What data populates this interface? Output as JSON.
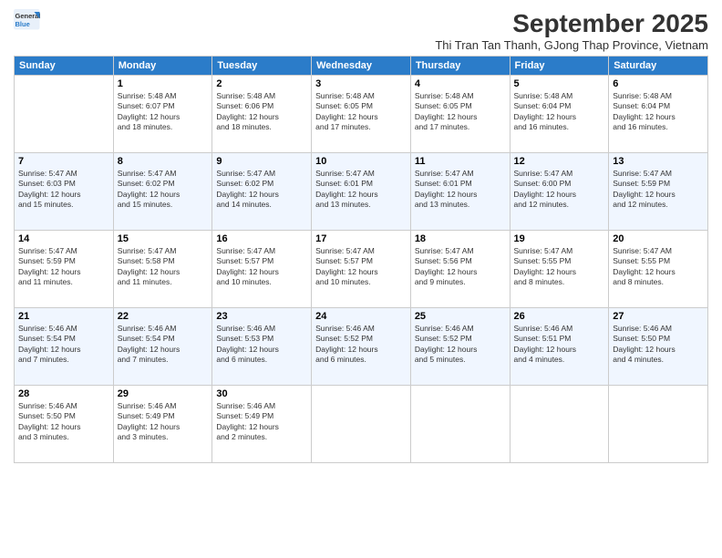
{
  "header": {
    "logo_line1": "General",
    "logo_line2": "Blue",
    "title": "September 2025",
    "subtitle": "Thi Tran Tan Thanh, GJong Thap Province, Vietnam"
  },
  "columns": [
    "Sunday",
    "Monday",
    "Tuesday",
    "Wednesday",
    "Thursday",
    "Friday",
    "Saturday"
  ],
  "weeks": [
    [
      {
        "day": "",
        "info": ""
      },
      {
        "day": "1",
        "info": "Sunrise: 5:48 AM\nSunset: 6:07 PM\nDaylight: 12 hours\nand 18 minutes."
      },
      {
        "day": "2",
        "info": "Sunrise: 5:48 AM\nSunset: 6:06 PM\nDaylight: 12 hours\nand 18 minutes."
      },
      {
        "day": "3",
        "info": "Sunrise: 5:48 AM\nSunset: 6:05 PM\nDaylight: 12 hours\nand 17 minutes."
      },
      {
        "day": "4",
        "info": "Sunrise: 5:48 AM\nSunset: 6:05 PM\nDaylight: 12 hours\nand 17 minutes."
      },
      {
        "day": "5",
        "info": "Sunrise: 5:48 AM\nSunset: 6:04 PM\nDaylight: 12 hours\nand 16 minutes."
      },
      {
        "day": "6",
        "info": "Sunrise: 5:48 AM\nSunset: 6:04 PM\nDaylight: 12 hours\nand 16 minutes."
      }
    ],
    [
      {
        "day": "7",
        "info": "Sunrise: 5:47 AM\nSunset: 6:03 PM\nDaylight: 12 hours\nand 15 minutes."
      },
      {
        "day": "8",
        "info": "Sunrise: 5:47 AM\nSunset: 6:02 PM\nDaylight: 12 hours\nand 15 minutes."
      },
      {
        "day": "9",
        "info": "Sunrise: 5:47 AM\nSunset: 6:02 PM\nDaylight: 12 hours\nand 14 minutes."
      },
      {
        "day": "10",
        "info": "Sunrise: 5:47 AM\nSunset: 6:01 PM\nDaylight: 12 hours\nand 13 minutes."
      },
      {
        "day": "11",
        "info": "Sunrise: 5:47 AM\nSunset: 6:01 PM\nDaylight: 12 hours\nand 13 minutes."
      },
      {
        "day": "12",
        "info": "Sunrise: 5:47 AM\nSunset: 6:00 PM\nDaylight: 12 hours\nand 12 minutes."
      },
      {
        "day": "13",
        "info": "Sunrise: 5:47 AM\nSunset: 5:59 PM\nDaylight: 12 hours\nand 12 minutes."
      }
    ],
    [
      {
        "day": "14",
        "info": "Sunrise: 5:47 AM\nSunset: 5:59 PM\nDaylight: 12 hours\nand 11 minutes."
      },
      {
        "day": "15",
        "info": "Sunrise: 5:47 AM\nSunset: 5:58 PM\nDaylight: 12 hours\nand 11 minutes."
      },
      {
        "day": "16",
        "info": "Sunrise: 5:47 AM\nSunset: 5:57 PM\nDaylight: 12 hours\nand 10 minutes."
      },
      {
        "day": "17",
        "info": "Sunrise: 5:47 AM\nSunset: 5:57 PM\nDaylight: 12 hours\nand 10 minutes."
      },
      {
        "day": "18",
        "info": "Sunrise: 5:47 AM\nSunset: 5:56 PM\nDaylight: 12 hours\nand 9 minutes."
      },
      {
        "day": "19",
        "info": "Sunrise: 5:47 AM\nSunset: 5:55 PM\nDaylight: 12 hours\nand 8 minutes."
      },
      {
        "day": "20",
        "info": "Sunrise: 5:47 AM\nSunset: 5:55 PM\nDaylight: 12 hours\nand 8 minutes."
      }
    ],
    [
      {
        "day": "21",
        "info": "Sunrise: 5:46 AM\nSunset: 5:54 PM\nDaylight: 12 hours\nand 7 minutes."
      },
      {
        "day": "22",
        "info": "Sunrise: 5:46 AM\nSunset: 5:54 PM\nDaylight: 12 hours\nand 7 minutes."
      },
      {
        "day": "23",
        "info": "Sunrise: 5:46 AM\nSunset: 5:53 PM\nDaylight: 12 hours\nand 6 minutes."
      },
      {
        "day": "24",
        "info": "Sunrise: 5:46 AM\nSunset: 5:52 PM\nDaylight: 12 hours\nand 6 minutes."
      },
      {
        "day": "25",
        "info": "Sunrise: 5:46 AM\nSunset: 5:52 PM\nDaylight: 12 hours\nand 5 minutes."
      },
      {
        "day": "26",
        "info": "Sunrise: 5:46 AM\nSunset: 5:51 PM\nDaylight: 12 hours\nand 4 minutes."
      },
      {
        "day": "27",
        "info": "Sunrise: 5:46 AM\nSunset: 5:50 PM\nDaylight: 12 hours\nand 4 minutes."
      }
    ],
    [
      {
        "day": "28",
        "info": "Sunrise: 5:46 AM\nSunset: 5:50 PM\nDaylight: 12 hours\nand 3 minutes."
      },
      {
        "day": "29",
        "info": "Sunrise: 5:46 AM\nSunset: 5:49 PM\nDaylight: 12 hours\nand 3 minutes."
      },
      {
        "day": "30",
        "info": "Sunrise: 5:46 AM\nSunset: 5:49 PM\nDaylight: 12 hours\nand 2 minutes."
      },
      {
        "day": "",
        "info": ""
      },
      {
        "day": "",
        "info": ""
      },
      {
        "day": "",
        "info": ""
      },
      {
        "day": "",
        "info": ""
      }
    ]
  ]
}
